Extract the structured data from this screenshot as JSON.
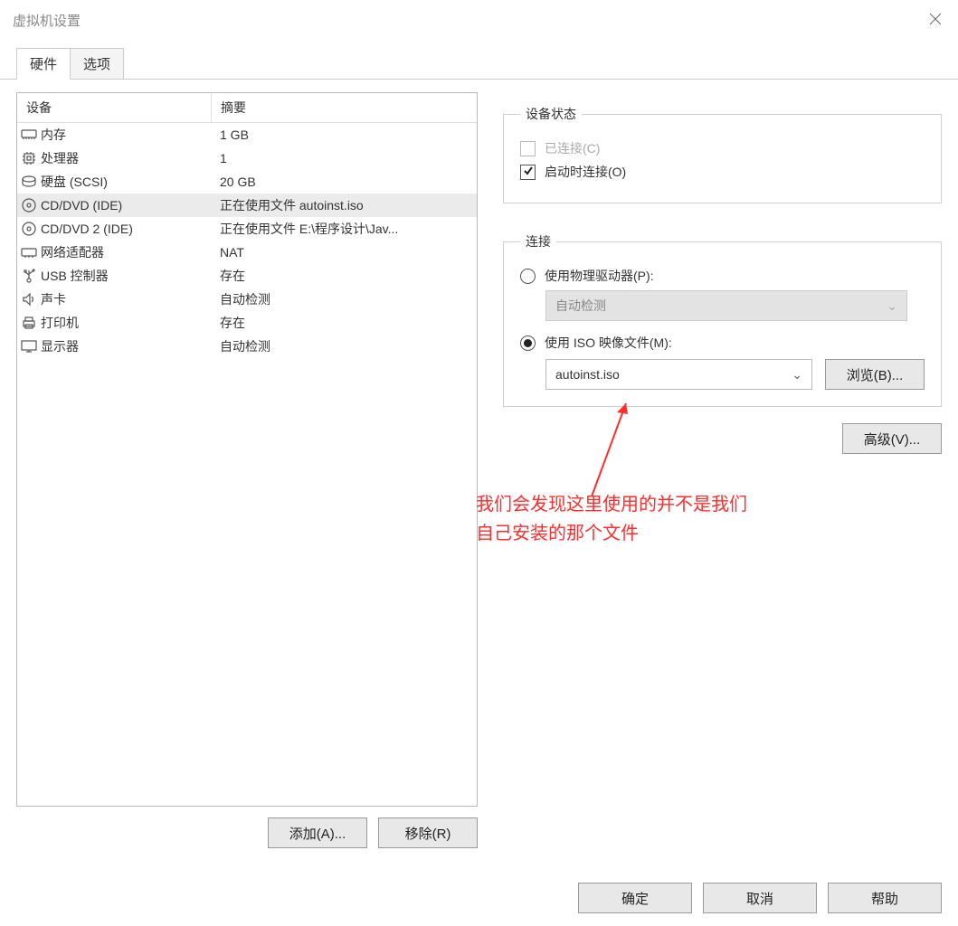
{
  "title": "虚拟机设置",
  "tabs": {
    "hardware": "硬件",
    "options": "选项"
  },
  "header": {
    "device": "设备",
    "summary": "摘要"
  },
  "devices": [
    {
      "icon": "memory-icon",
      "name": "内存",
      "summary": "1 GB"
    },
    {
      "icon": "cpu-icon",
      "name": "处理器",
      "summary": "1"
    },
    {
      "icon": "disk-icon",
      "name": "硬盘 (SCSI)",
      "summary": "20 GB"
    },
    {
      "icon": "disc-icon",
      "name": "CD/DVD (IDE)",
      "summary": "正在使用文件 autoinst.iso",
      "selected": true
    },
    {
      "icon": "disc-icon",
      "name": "CD/DVD 2 (IDE)",
      "summary": "正在使用文件 E:\\程序设计\\Jav..."
    },
    {
      "icon": "network-icon",
      "name": "网络适配器",
      "summary": "NAT"
    },
    {
      "icon": "usb-icon",
      "name": "USB 控制器",
      "summary": "存在"
    },
    {
      "icon": "sound-icon",
      "name": "声卡",
      "summary": "自动检测"
    },
    {
      "icon": "printer-icon",
      "name": "打印机",
      "summary": "存在"
    },
    {
      "icon": "display-icon",
      "name": "显示器",
      "summary": "自动检测"
    }
  ],
  "buttons": {
    "add": "添加(A)...",
    "remove": "移除(R)",
    "browse": "浏览(B)...",
    "advanced": "高级(V)...",
    "ok": "确定",
    "cancel": "取消",
    "help": "帮助"
  },
  "sections": {
    "device_state": "设备状态",
    "connection": "连接"
  },
  "device_state": {
    "connected": "已连接(C)",
    "connect_at_poweron": "启动时连接(O)"
  },
  "connection": {
    "use_physical": "使用物理驱动器(P):",
    "physical_value": "自动检测",
    "use_iso": "使用 ISO 映像文件(M):",
    "iso_value": "autoinst.iso"
  },
  "annotation": {
    "line1": "我们会发现这里使用的并不是我们",
    "line2": "自己安装的那个文件"
  }
}
